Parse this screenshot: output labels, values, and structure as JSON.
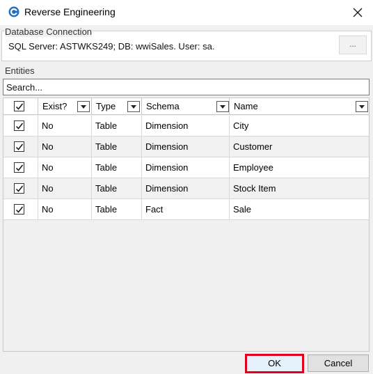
{
  "window": {
    "title": "Reverse Engineering",
    "icon": "app-logo-icon",
    "close_icon": "close-icon"
  },
  "connection": {
    "group_label": "Database Connection",
    "text": "SQL Server:  ASTWKS249; DB: wwiSales. User: sa.",
    "browse_label": "..."
  },
  "entities": {
    "group_label": "Entities",
    "search_placeholder": "Search...",
    "columns": [
      "Exist?",
      "Type",
      "Schema",
      "Name"
    ],
    "header_checked": true,
    "rows": [
      {
        "checked": true,
        "exist": "No",
        "type": "Table",
        "schema": "Dimension",
        "name": "City"
      },
      {
        "checked": true,
        "exist": "No",
        "type": "Table",
        "schema": "Dimension",
        "name": "Customer"
      },
      {
        "checked": true,
        "exist": "No",
        "type": "Table",
        "schema": "Dimension",
        "name": "Employee"
      },
      {
        "checked": true,
        "exist": "No",
        "type": "Table",
        "schema": "Dimension",
        "name": "Stock Item"
      },
      {
        "checked": true,
        "exist": "No",
        "type": "Table",
        "schema": "Fact",
        "name": "Sale"
      }
    ]
  },
  "buttons": {
    "ok": "OK",
    "cancel": "Cancel"
  },
  "colors": {
    "ok_highlight": "#e0001b",
    "icon_blue": "#1f6fc5"
  }
}
